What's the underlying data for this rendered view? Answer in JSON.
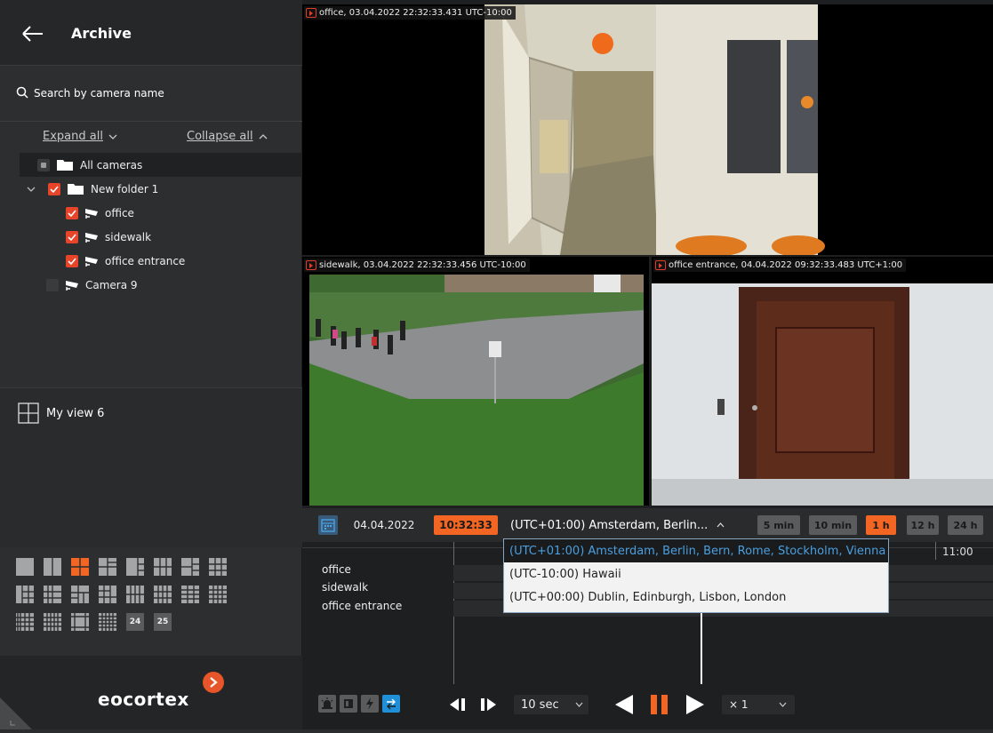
{
  "sidebar": {
    "title": "Archive",
    "search_placeholder": "Search by camera name",
    "expand_all": "Expand all",
    "collapse_all": "Collapse all",
    "tree": [
      {
        "label": "All cameras",
        "type": "folder",
        "check": "partial"
      },
      {
        "label": "New folder 1",
        "type": "folder",
        "check": "on"
      },
      {
        "label": "office",
        "type": "camera",
        "check": "on"
      },
      {
        "label": "sidewalk",
        "type": "camera",
        "check": "on"
      },
      {
        "label": "office entrance",
        "type": "camera",
        "check": "on"
      },
      {
        "label": "Camera 9",
        "type": "camera",
        "check": "off"
      }
    ],
    "view_name": "My view 6",
    "layout_numbers": [
      "24",
      "25"
    ],
    "brand": "eocortex"
  },
  "videos": [
    {
      "label": "office, 03.04.2022 22:32:33.431 UTC-10:00"
    },
    {
      "label": "sidewalk, 03.04.2022 22:32:33.456 UTC-10:00"
    },
    {
      "label": "office entrance, 04.04.2022 09:32:33.483 UTC+1:00"
    }
  ],
  "controls": {
    "date": "04.04.2022",
    "time": "10:32:33",
    "timezone": "(UTC+01:00) Amsterdam, Berlin...",
    "scales": [
      "5 min",
      "10 min",
      "1 h",
      "12 h",
      "24 h"
    ],
    "active_scale": "1 h"
  },
  "timezone_options": [
    "(UTC+01:00) Amsterdam, Berlin, Bern, Rome, Stockholm, Vienna",
    "(UTC-10:00) Hawaii",
    "(UTC+00:00) Dublin, Edinburgh, Lisbon, London"
  ],
  "timeline": {
    "cameras": [
      "office",
      "sidewalk",
      "office entrance"
    ],
    "tick_label": "11:00"
  },
  "playback": {
    "step": "10 sec",
    "speed": "× 1"
  },
  "colors": {
    "accent": "#f26522",
    "checkbox": "#e8442a",
    "highlight": "#4a9fe0"
  }
}
